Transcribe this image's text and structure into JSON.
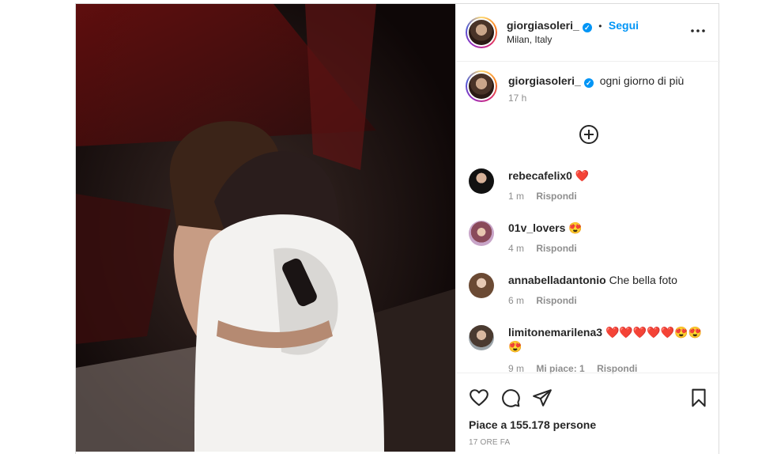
{
  "post": {
    "author": "giorgiasoleri_",
    "dot": "•",
    "follow_label": "Segui",
    "location": "Milan, Italy",
    "more_icon": "more-horizontal-icon",
    "caption": "ogni giorno di più",
    "caption_time": "17 h",
    "load_more_icon": "plus-circle-icon",
    "verified_glyph": "✓"
  },
  "comments": [
    {
      "user": "rebecafelix0",
      "text": "❤️",
      "time": "1 m",
      "likes": "",
      "reply": "Rispondi"
    },
    {
      "user": "01v_lovers",
      "text": "😍",
      "time": "4 m",
      "likes": "",
      "reply": "Rispondi"
    },
    {
      "user": "annabelladantonio",
      "text": "Che bella foto",
      "time": "6 m",
      "likes": "",
      "reply": "Rispondi"
    },
    {
      "user": "limitonemarilena3",
      "text": "❤️❤️❤️❤️❤️😍😍😍",
      "time": "9 m",
      "likes": "Mi piace: 1",
      "reply": "Rispondi"
    }
  ],
  "actions": {
    "like_icon": "heart-icon",
    "comment_icon": "comment-bubble-icon",
    "share_icon": "paper-plane-icon",
    "save_icon": "bookmark-icon",
    "likes_text": "Piace a 155.178 persone",
    "time_ago": "17 ORE FA"
  },
  "colors": {
    "accent": "#0095f6",
    "text": "#262626",
    "muted": "#8e8e8e",
    "border": "#dbdbdb"
  }
}
